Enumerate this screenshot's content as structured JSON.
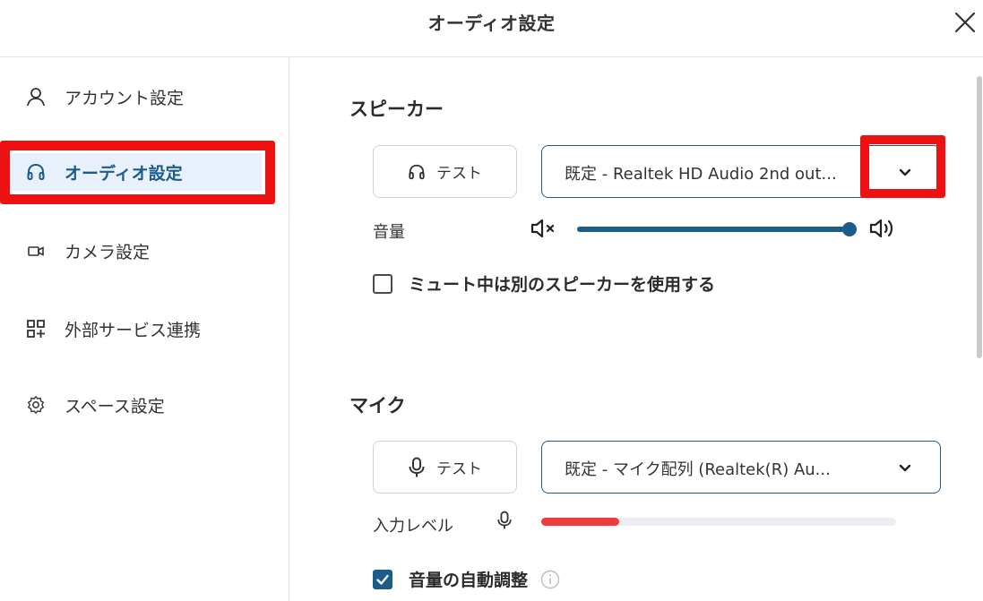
{
  "header": {
    "title": "オーディオ設定"
  },
  "sidebar": {
    "items": [
      {
        "label": "アカウント設定",
        "icon": "person-icon"
      },
      {
        "label": "オーディオ設定",
        "icon": "headphones-icon",
        "active": true
      },
      {
        "label": "カメラ設定",
        "icon": "camera-icon"
      },
      {
        "label": "外部サービス連携",
        "icon": "apps-plus-icon"
      },
      {
        "label": "スペース設定",
        "icon": "gear-icon"
      }
    ]
  },
  "speaker": {
    "title": "スピーカー",
    "test_label": "テスト",
    "device_value": "既定 - Realtek HD Audio 2nd out...",
    "volume_label": "音量",
    "volume_level": 1.0,
    "mute_option_label": "ミュート中は別のスピーカーを使用する",
    "mute_option_checked": false
  },
  "mic": {
    "title": "マイク",
    "test_label": "テスト",
    "device_value": "既定 - マイク配列 (Realtek(R) Au...",
    "input_level_label": "入力レベル",
    "input_level": 0.22,
    "auto_adjust_label": "音量の自動調整",
    "auto_adjust_checked": true
  },
  "colors": {
    "accent": "#1b5c8a",
    "highlight_red": "#ee1111",
    "level_red": "#ef3b3b",
    "active_bg": "#e8f1fb"
  }
}
